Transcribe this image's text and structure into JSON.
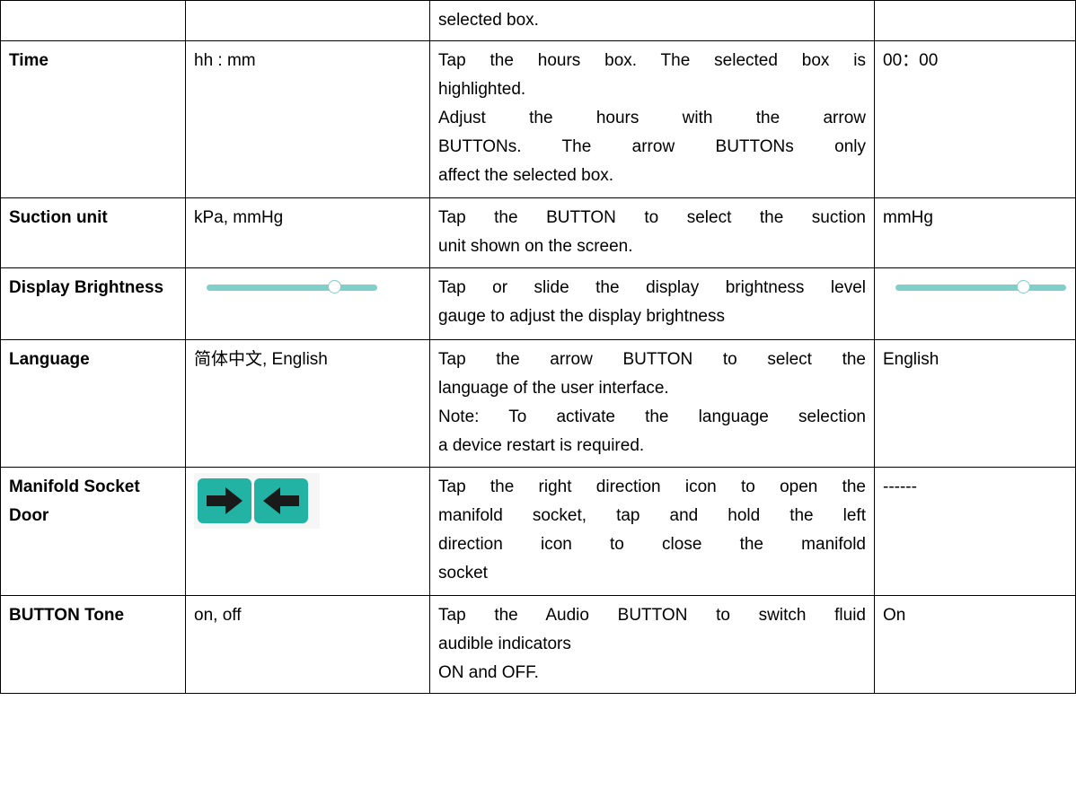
{
  "rows": [
    {
      "name": "",
      "options": "",
      "description": [
        "selected box."
      ],
      "default": ""
    },
    {
      "name": "Time",
      "options": "hh : mm",
      "description": [
        "Tap the hours box. The selected box is",
        "highlighted.",
        "Adjust the hours with the arrow",
        "BUTTONs. The arrow BUTTONs only",
        "affect the selected box."
      ],
      "default": "00：00"
    },
    {
      "name": "Suction unit",
      "options": "kPa, mmHg",
      "description": [
        "Tap the BUTTON to select the suction",
        "unit shown on the screen."
      ],
      "default": "mmHg"
    },
    {
      "name": "Display Brightness",
      "options_slider_level": 0.75,
      "description": [
        "Tap or slide the display brightness level",
        "gauge to adjust the display brightness"
      ],
      "default_slider_level": 0.75
    },
    {
      "name": "Language",
      "options": "简体中文, English",
      "description": [
        "Tap the arrow BUTTON to select the",
        "language of the user interface.",
        "Note: To activate the language selection",
        "a device restart is required."
      ],
      "default": "English"
    },
    {
      "name": "Manifold Socket Door",
      "options_icons": [
        "right-arrow-icon",
        "left-arrow-icon"
      ],
      "description": [
        "Tap the right direction icon to open the",
        "manifold socket, tap and hold the left",
        "direction icon to close the manifold",
        "socket"
      ],
      "default": "------"
    },
    {
      "name": "BUTTON Tone",
      "options": "on, off",
      "description": [
        "Tap the Audio BUTTON to switch fluid",
        "audible indicators",
        "ON and OFF."
      ],
      "default": "On"
    }
  ],
  "colors": {
    "accent": "#22b3a5",
    "slider": "#80cfc9"
  }
}
